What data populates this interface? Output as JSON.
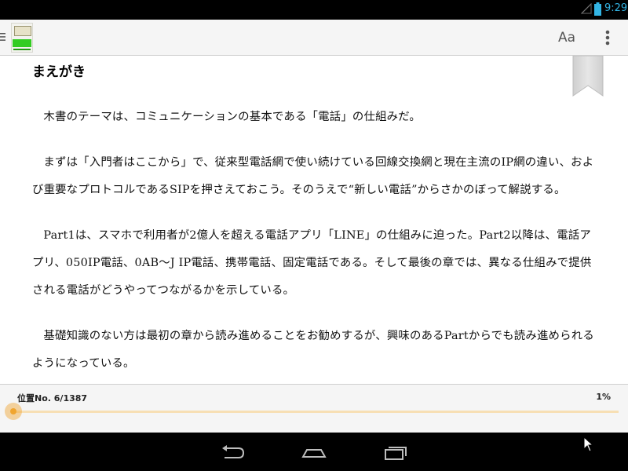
{
  "status_bar": {
    "time": "9:29",
    "icons": [
      "signal-icon",
      "battery-icon"
    ],
    "accent_color": "#33b5e5"
  },
  "action_bar": {
    "font_button_label": "Aa",
    "icons": [
      "menu-icon",
      "book-cover-thumbnail",
      "overflow-menu-icon"
    ]
  },
  "reader": {
    "chapter_title": "まえがき",
    "paragraphs": [
      "木書のテーマは、コミュニケーションの基本である「電話」の仕組みだ。",
      "まずは「入門者はここから」で、従来型電話網で使い続けている回線交換網と現在主流のIP網の違い、および重要なプロトコルであるSIPを押さえておこう。そのうえで“新しい電話”からさかのぼって解説する。",
      "Part1は、スマホで利用者が2億人を超える電話アプリ「LINE」の仕組みに迫った。Part2以降は、電話アプリ、050IP電話、0AB～J IP電話、携帯電話、固定電話である。そして最後の章では、異なる仕組みで提供される電話がどうやってつながるかを示している。",
      "基礎知識のない方は最初の章から読み進めることをお勧めするが、興味のあるPartからでも読み進められるようになっている。"
    ],
    "bookmark_icon": "bookmark-ribbon-icon"
  },
  "location": {
    "label": "位置No. 6/1387",
    "percent_label": "1%",
    "progress_fraction": 0.0036,
    "accent_color": "#f0a530"
  },
  "nav_bar": {
    "icons": [
      "back-icon",
      "home-icon",
      "recents-icon"
    ]
  }
}
